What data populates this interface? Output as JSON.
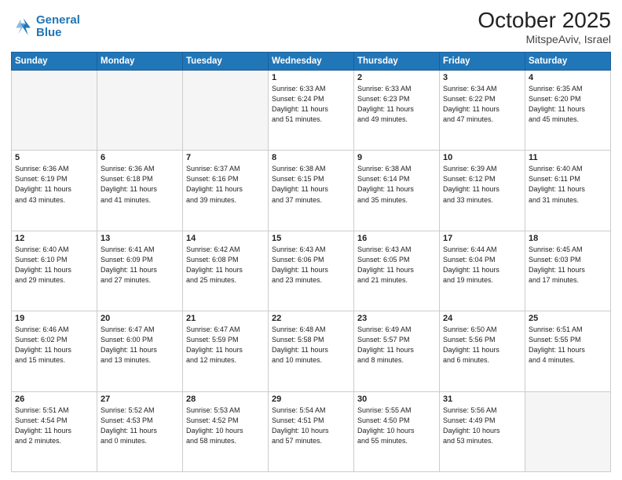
{
  "header": {
    "logo_line1": "General",
    "logo_line2": "Blue",
    "month_year": "October 2025",
    "location": "MitspeAviv, Israel"
  },
  "days_of_week": [
    "Sunday",
    "Monday",
    "Tuesday",
    "Wednesday",
    "Thursday",
    "Friday",
    "Saturday"
  ],
  "weeks": [
    [
      {
        "day": "",
        "info": ""
      },
      {
        "day": "",
        "info": ""
      },
      {
        "day": "",
        "info": ""
      },
      {
        "day": "1",
        "info": "Sunrise: 6:33 AM\nSunset: 6:24 PM\nDaylight: 11 hours\nand 51 minutes."
      },
      {
        "day": "2",
        "info": "Sunrise: 6:33 AM\nSunset: 6:23 PM\nDaylight: 11 hours\nand 49 minutes."
      },
      {
        "day": "3",
        "info": "Sunrise: 6:34 AM\nSunset: 6:22 PM\nDaylight: 11 hours\nand 47 minutes."
      },
      {
        "day": "4",
        "info": "Sunrise: 6:35 AM\nSunset: 6:20 PM\nDaylight: 11 hours\nand 45 minutes."
      }
    ],
    [
      {
        "day": "5",
        "info": "Sunrise: 6:36 AM\nSunset: 6:19 PM\nDaylight: 11 hours\nand 43 minutes."
      },
      {
        "day": "6",
        "info": "Sunrise: 6:36 AM\nSunset: 6:18 PM\nDaylight: 11 hours\nand 41 minutes."
      },
      {
        "day": "7",
        "info": "Sunrise: 6:37 AM\nSunset: 6:16 PM\nDaylight: 11 hours\nand 39 minutes."
      },
      {
        "day": "8",
        "info": "Sunrise: 6:38 AM\nSunset: 6:15 PM\nDaylight: 11 hours\nand 37 minutes."
      },
      {
        "day": "9",
        "info": "Sunrise: 6:38 AM\nSunset: 6:14 PM\nDaylight: 11 hours\nand 35 minutes."
      },
      {
        "day": "10",
        "info": "Sunrise: 6:39 AM\nSunset: 6:12 PM\nDaylight: 11 hours\nand 33 minutes."
      },
      {
        "day": "11",
        "info": "Sunrise: 6:40 AM\nSunset: 6:11 PM\nDaylight: 11 hours\nand 31 minutes."
      }
    ],
    [
      {
        "day": "12",
        "info": "Sunrise: 6:40 AM\nSunset: 6:10 PM\nDaylight: 11 hours\nand 29 minutes."
      },
      {
        "day": "13",
        "info": "Sunrise: 6:41 AM\nSunset: 6:09 PM\nDaylight: 11 hours\nand 27 minutes."
      },
      {
        "day": "14",
        "info": "Sunrise: 6:42 AM\nSunset: 6:08 PM\nDaylight: 11 hours\nand 25 minutes."
      },
      {
        "day": "15",
        "info": "Sunrise: 6:43 AM\nSunset: 6:06 PM\nDaylight: 11 hours\nand 23 minutes."
      },
      {
        "day": "16",
        "info": "Sunrise: 6:43 AM\nSunset: 6:05 PM\nDaylight: 11 hours\nand 21 minutes."
      },
      {
        "day": "17",
        "info": "Sunrise: 6:44 AM\nSunset: 6:04 PM\nDaylight: 11 hours\nand 19 minutes."
      },
      {
        "day": "18",
        "info": "Sunrise: 6:45 AM\nSunset: 6:03 PM\nDaylight: 11 hours\nand 17 minutes."
      }
    ],
    [
      {
        "day": "19",
        "info": "Sunrise: 6:46 AM\nSunset: 6:02 PM\nDaylight: 11 hours\nand 15 minutes."
      },
      {
        "day": "20",
        "info": "Sunrise: 6:47 AM\nSunset: 6:00 PM\nDaylight: 11 hours\nand 13 minutes."
      },
      {
        "day": "21",
        "info": "Sunrise: 6:47 AM\nSunset: 5:59 PM\nDaylight: 11 hours\nand 12 minutes."
      },
      {
        "day": "22",
        "info": "Sunrise: 6:48 AM\nSunset: 5:58 PM\nDaylight: 11 hours\nand 10 minutes."
      },
      {
        "day": "23",
        "info": "Sunrise: 6:49 AM\nSunset: 5:57 PM\nDaylight: 11 hours\nand 8 minutes."
      },
      {
        "day": "24",
        "info": "Sunrise: 6:50 AM\nSunset: 5:56 PM\nDaylight: 11 hours\nand 6 minutes."
      },
      {
        "day": "25",
        "info": "Sunrise: 6:51 AM\nSunset: 5:55 PM\nDaylight: 11 hours\nand 4 minutes."
      }
    ],
    [
      {
        "day": "26",
        "info": "Sunrise: 5:51 AM\nSunset: 4:54 PM\nDaylight: 11 hours\nand 2 minutes."
      },
      {
        "day": "27",
        "info": "Sunrise: 5:52 AM\nSunset: 4:53 PM\nDaylight: 11 hours\nand 0 minutes."
      },
      {
        "day": "28",
        "info": "Sunrise: 5:53 AM\nSunset: 4:52 PM\nDaylight: 10 hours\nand 58 minutes."
      },
      {
        "day": "29",
        "info": "Sunrise: 5:54 AM\nSunset: 4:51 PM\nDaylight: 10 hours\nand 57 minutes."
      },
      {
        "day": "30",
        "info": "Sunrise: 5:55 AM\nSunset: 4:50 PM\nDaylight: 10 hours\nand 55 minutes."
      },
      {
        "day": "31",
        "info": "Sunrise: 5:56 AM\nSunset: 4:49 PM\nDaylight: 10 hours\nand 53 minutes."
      },
      {
        "day": "",
        "info": ""
      }
    ]
  ]
}
